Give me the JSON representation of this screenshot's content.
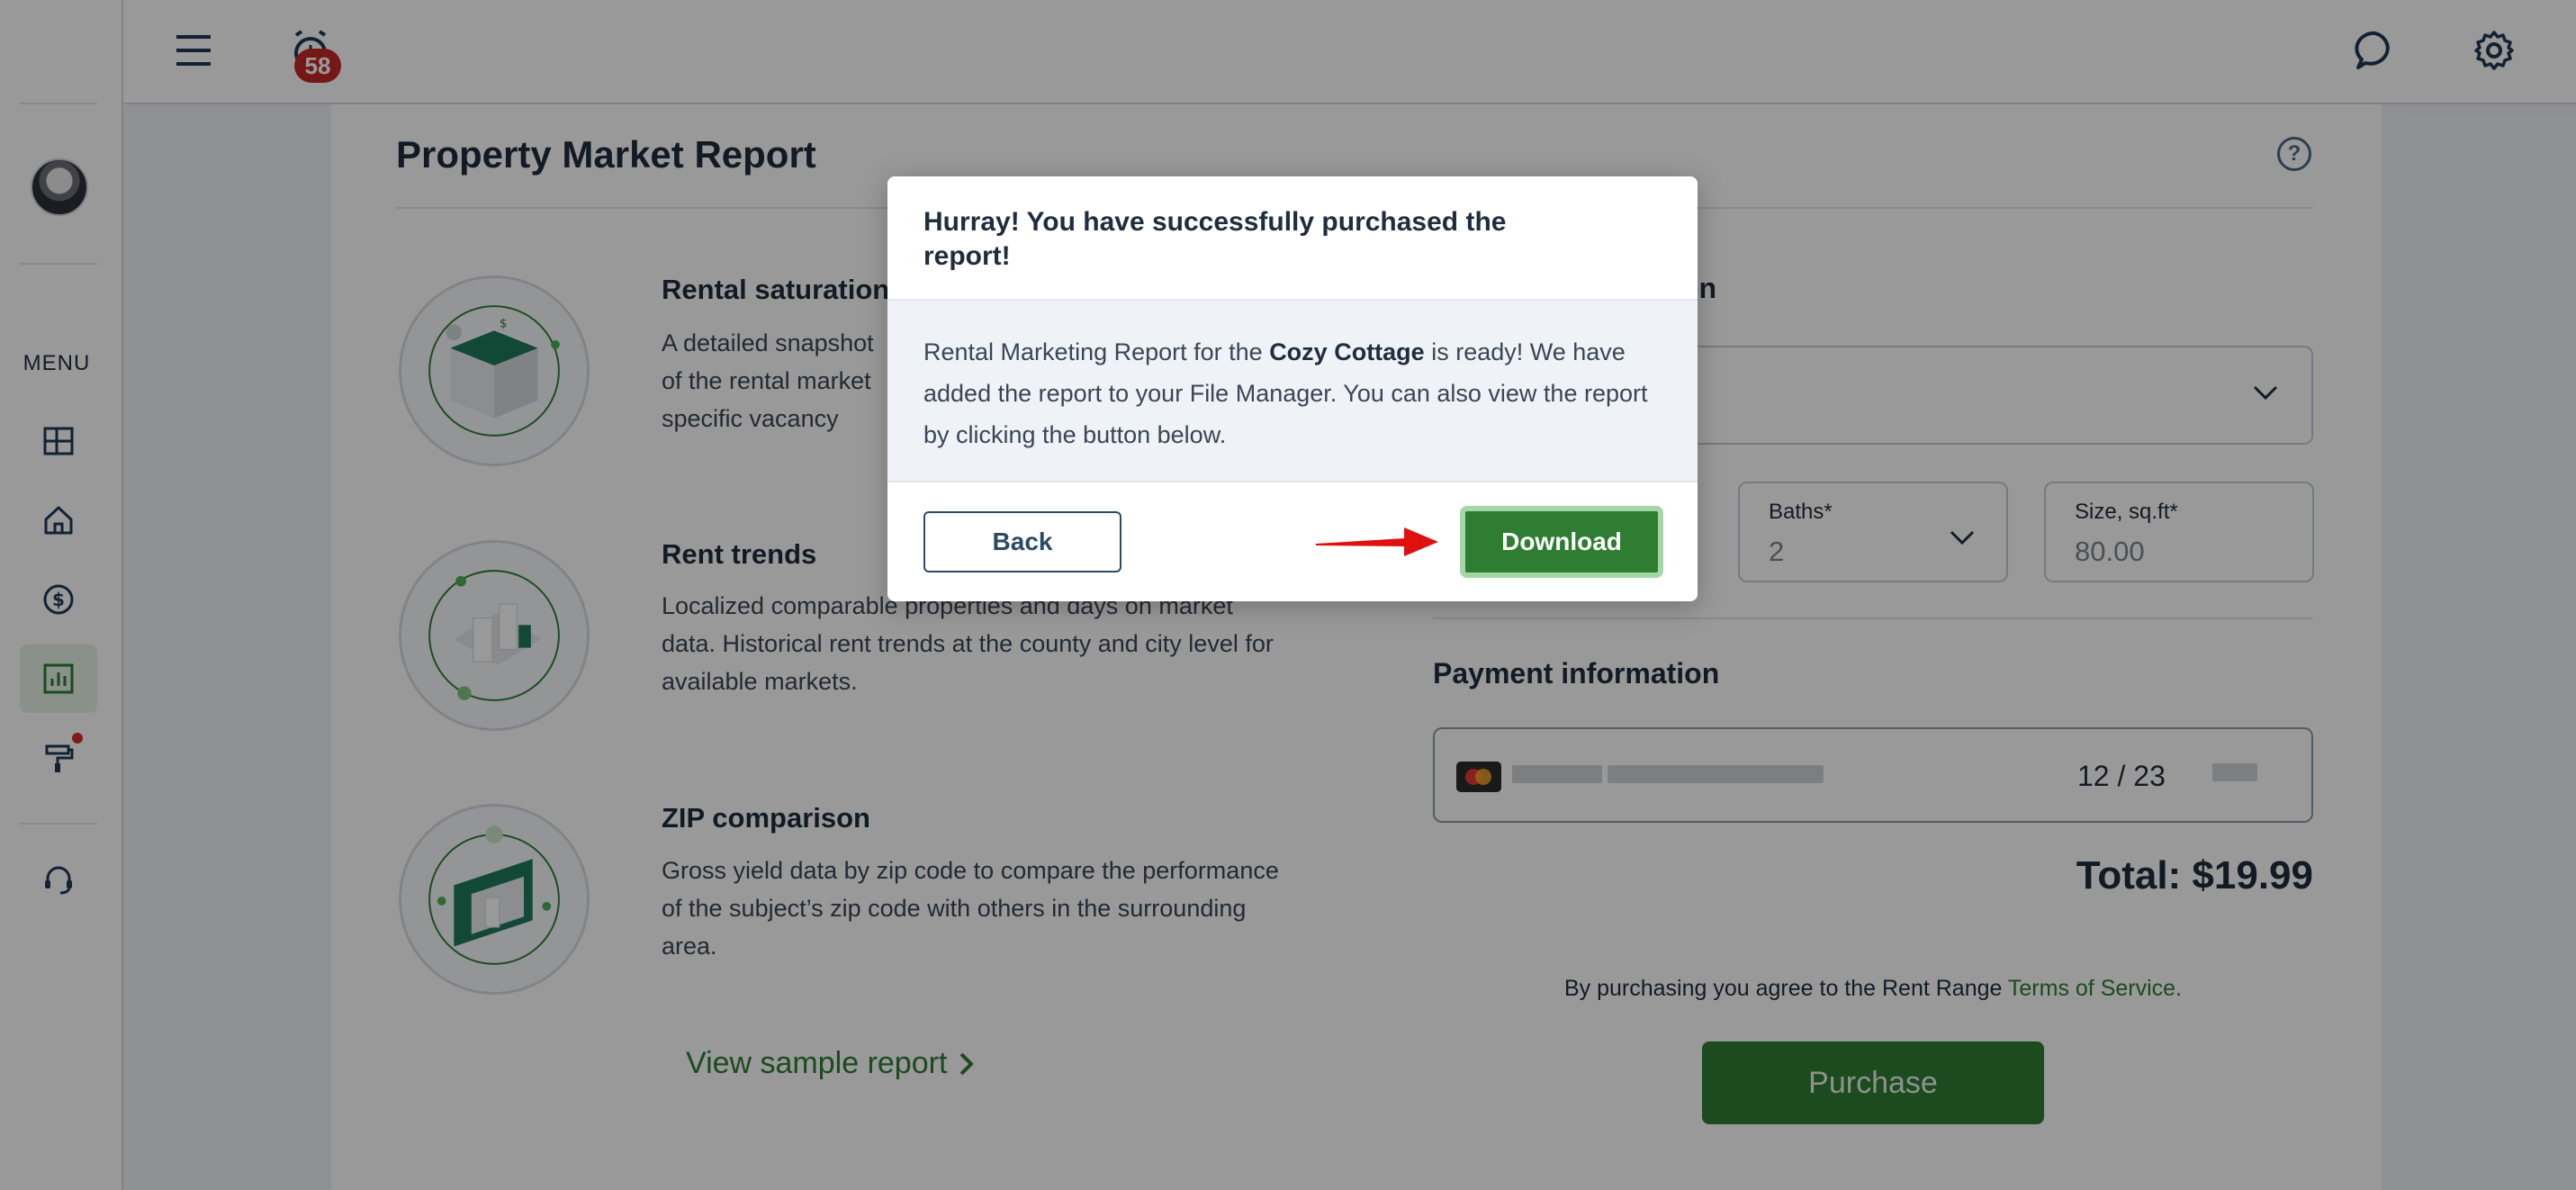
{
  "sidebar": {
    "menu_label": "MENU",
    "icons": [
      "dashboard-icon",
      "home-icon",
      "dollar-icon",
      "reports-icon",
      "tools-icon",
      "support-icon"
    ]
  },
  "topbar": {
    "notification_count": "58"
  },
  "page": {
    "title": "Property Market Report",
    "features": [
      {
        "title": "Rental saturation",
        "description": "A detailed snapshot of the rental market specific vacancy rates and benchmarks in the area."
      },
      {
        "title": "Rent trends",
        "description": "Localized comparable properties and days on market data. Historical rent trends at the county and city level for available markets."
      },
      {
        "title": "ZIP comparison",
        "description": "Gross yield data by zip code to compare the performance of the subject’s zip code with others in the surrounding area."
      }
    ],
    "sample_link": "View sample report"
  },
  "property": {
    "section_title_fragment": "on",
    "baths_label": "Baths*",
    "baths_value": "2",
    "size_label": "Size, sq.ft*",
    "size_placeholder": "80.00"
  },
  "payment": {
    "title": "Payment information",
    "expiry": "12 / 23",
    "total": "Total: $19.99",
    "terms_prefix": "By purchasing you agree to the Rent Range ",
    "terms_link": "Terms of Service.",
    "purchase_label": "Purchase"
  },
  "modal": {
    "title": "Hurray! You have successfully purchased the report!",
    "body_prefix": "Rental Marketing Report for the ",
    "property_name": "Cozy Cottage",
    "body_suffix": " is ready! We have added the report to your File Manager. You can also view the report by clicking the button below.",
    "back_label": "Back",
    "download_label": "Download"
  },
  "colors": {
    "accent_green": "#2e7d32",
    "badge_red": "#c62828",
    "arrow_red": "#e01010"
  }
}
